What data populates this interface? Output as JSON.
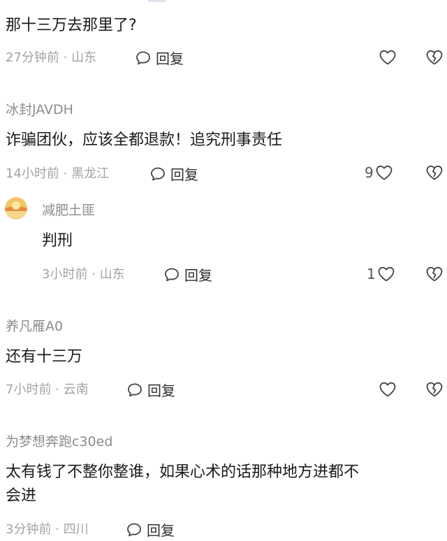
{
  "comments": [
    {
      "user": "",
      "content": "那十三万去那里了?",
      "meta": "27分钟前 · 山东",
      "reply_label": "回复",
      "likes": ""
    },
    {
      "user": "冰封JAVDH",
      "content": "诈骗团伙，应该全都退款！追究刑事责任",
      "meta": "14小时前 · 黑龙江",
      "reply_label": "回复",
      "likes": "9"
    },
    {
      "user": "减肥土匪",
      "content": "判刑",
      "meta": "3小时前 · 山东",
      "reply_label": "回复",
      "likes": "1"
    },
    {
      "user": "养凡雁A0",
      "content": "还有十三万",
      "meta": "7小时前 · 云南",
      "reply_label": "回复",
      "likes": ""
    },
    {
      "user": "为梦想奔跑c30ed",
      "content_line1": "太有钱了不整你整谁，如果心术的话那种地方进都不",
      "content_line2": "会进",
      "meta": "3分钟前 · 四川",
      "reply_label": "回复"
    }
  ],
  "icons": {
    "reply": "speech-bubble-icon",
    "like": "heart-outline-icon",
    "dislike": "broken-heart-icon"
  },
  "colors": {
    "text": "#1a1a1a",
    "muted": "#a3a3a3",
    "username": "#8c8c8c",
    "icon": "#444444"
  }
}
